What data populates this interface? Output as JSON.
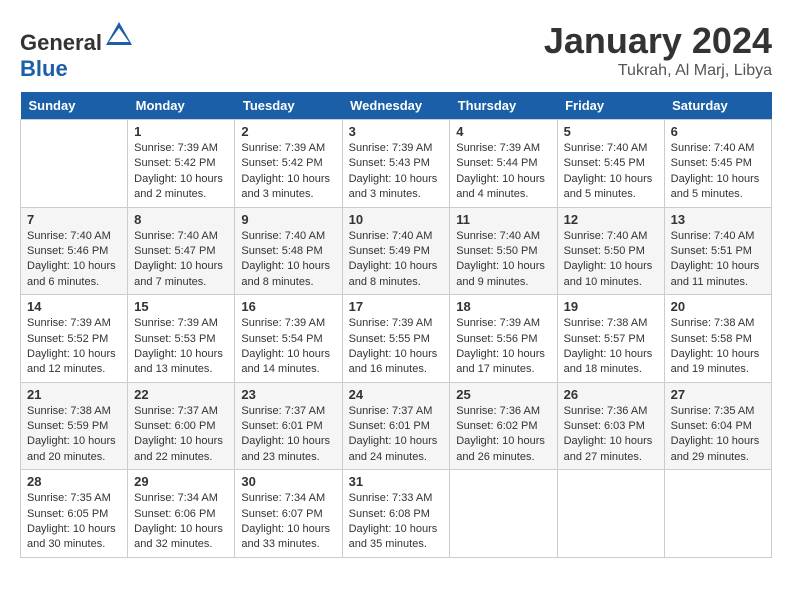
{
  "header": {
    "logo_general": "General",
    "logo_blue": "Blue",
    "month_title": "January 2024",
    "location": "Tukrah, Al Marj, Libya"
  },
  "days_of_week": [
    "Sunday",
    "Monday",
    "Tuesday",
    "Wednesday",
    "Thursday",
    "Friday",
    "Saturday"
  ],
  "weeks": [
    [
      {
        "day": "",
        "info": ""
      },
      {
        "day": "1",
        "info": "Sunrise: 7:39 AM\nSunset: 5:42 PM\nDaylight: 10 hours\nand 2 minutes."
      },
      {
        "day": "2",
        "info": "Sunrise: 7:39 AM\nSunset: 5:42 PM\nDaylight: 10 hours\nand 3 minutes."
      },
      {
        "day": "3",
        "info": "Sunrise: 7:39 AM\nSunset: 5:43 PM\nDaylight: 10 hours\nand 3 minutes."
      },
      {
        "day": "4",
        "info": "Sunrise: 7:39 AM\nSunset: 5:44 PM\nDaylight: 10 hours\nand 4 minutes."
      },
      {
        "day": "5",
        "info": "Sunrise: 7:40 AM\nSunset: 5:45 PM\nDaylight: 10 hours\nand 5 minutes."
      },
      {
        "day": "6",
        "info": "Sunrise: 7:40 AM\nSunset: 5:45 PM\nDaylight: 10 hours\nand 5 minutes."
      }
    ],
    [
      {
        "day": "7",
        "info": "Sunrise: 7:40 AM\nSunset: 5:46 PM\nDaylight: 10 hours\nand 6 minutes."
      },
      {
        "day": "8",
        "info": "Sunrise: 7:40 AM\nSunset: 5:47 PM\nDaylight: 10 hours\nand 7 minutes."
      },
      {
        "day": "9",
        "info": "Sunrise: 7:40 AM\nSunset: 5:48 PM\nDaylight: 10 hours\nand 8 minutes."
      },
      {
        "day": "10",
        "info": "Sunrise: 7:40 AM\nSunset: 5:49 PM\nDaylight: 10 hours\nand 8 minutes."
      },
      {
        "day": "11",
        "info": "Sunrise: 7:40 AM\nSunset: 5:50 PM\nDaylight: 10 hours\nand 9 minutes."
      },
      {
        "day": "12",
        "info": "Sunrise: 7:40 AM\nSunset: 5:50 PM\nDaylight: 10 hours\nand 10 minutes."
      },
      {
        "day": "13",
        "info": "Sunrise: 7:40 AM\nSunset: 5:51 PM\nDaylight: 10 hours\nand 11 minutes."
      }
    ],
    [
      {
        "day": "14",
        "info": "Sunrise: 7:39 AM\nSunset: 5:52 PM\nDaylight: 10 hours\nand 12 minutes."
      },
      {
        "day": "15",
        "info": "Sunrise: 7:39 AM\nSunset: 5:53 PM\nDaylight: 10 hours\nand 13 minutes."
      },
      {
        "day": "16",
        "info": "Sunrise: 7:39 AM\nSunset: 5:54 PM\nDaylight: 10 hours\nand 14 minutes."
      },
      {
        "day": "17",
        "info": "Sunrise: 7:39 AM\nSunset: 5:55 PM\nDaylight: 10 hours\nand 16 minutes."
      },
      {
        "day": "18",
        "info": "Sunrise: 7:39 AM\nSunset: 5:56 PM\nDaylight: 10 hours\nand 17 minutes."
      },
      {
        "day": "19",
        "info": "Sunrise: 7:38 AM\nSunset: 5:57 PM\nDaylight: 10 hours\nand 18 minutes."
      },
      {
        "day": "20",
        "info": "Sunrise: 7:38 AM\nSunset: 5:58 PM\nDaylight: 10 hours\nand 19 minutes."
      }
    ],
    [
      {
        "day": "21",
        "info": "Sunrise: 7:38 AM\nSunset: 5:59 PM\nDaylight: 10 hours\nand 20 minutes."
      },
      {
        "day": "22",
        "info": "Sunrise: 7:37 AM\nSunset: 6:00 PM\nDaylight: 10 hours\nand 22 minutes."
      },
      {
        "day": "23",
        "info": "Sunrise: 7:37 AM\nSunset: 6:01 PM\nDaylight: 10 hours\nand 23 minutes."
      },
      {
        "day": "24",
        "info": "Sunrise: 7:37 AM\nSunset: 6:01 PM\nDaylight: 10 hours\nand 24 minutes."
      },
      {
        "day": "25",
        "info": "Sunrise: 7:36 AM\nSunset: 6:02 PM\nDaylight: 10 hours\nand 26 minutes."
      },
      {
        "day": "26",
        "info": "Sunrise: 7:36 AM\nSunset: 6:03 PM\nDaylight: 10 hours\nand 27 minutes."
      },
      {
        "day": "27",
        "info": "Sunrise: 7:35 AM\nSunset: 6:04 PM\nDaylight: 10 hours\nand 29 minutes."
      }
    ],
    [
      {
        "day": "28",
        "info": "Sunrise: 7:35 AM\nSunset: 6:05 PM\nDaylight: 10 hours\nand 30 minutes."
      },
      {
        "day": "29",
        "info": "Sunrise: 7:34 AM\nSunset: 6:06 PM\nDaylight: 10 hours\nand 32 minutes."
      },
      {
        "day": "30",
        "info": "Sunrise: 7:34 AM\nSunset: 6:07 PM\nDaylight: 10 hours\nand 33 minutes."
      },
      {
        "day": "31",
        "info": "Sunrise: 7:33 AM\nSunset: 6:08 PM\nDaylight: 10 hours\nand 35 minutes."
      },
      {
        "day": "",
        "info": ""
      },
      {
        "day": "",
        "info": ""
      },
      {
        "day": "",
        "info": ""
      }
    ]
  ]
}
